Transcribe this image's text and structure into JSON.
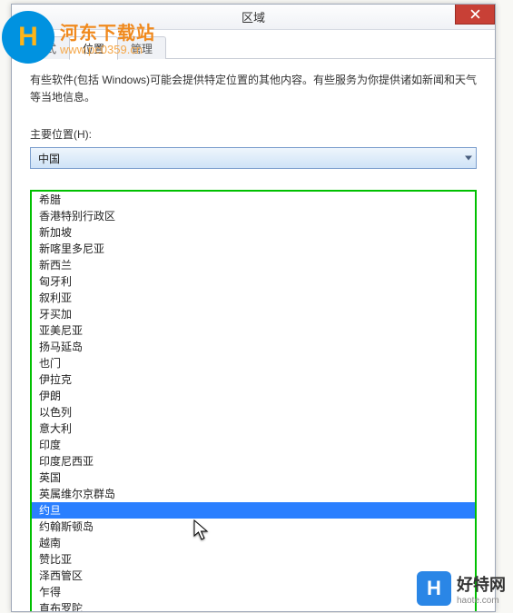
{
  "window": {
    "title": "区域",
    "close_icon": "close"
  },
  "tabs": {
    "t1": "格式",
    "t2": "位置",
    "t3": "管理"
  },
  "body": {
    "description": "有些软件(包括 Windows)可能会提供特定位置的其他内容。有些服务为你提供诸如新闻和天气等当地信息。",
    "field_label": "主要位置(H):",
    "selected_value": "中国"
  },
  "options": [
    "希腊",
    "香港特别行政区",
    "新加坡",
    "新喀里多尼亚",
    "新西兰",
    "匈牙利",
    "叙利亚",
    "牙买加",
    "亚美尼亚",
    "扬马延岛",
    "也门",
    "伊拉克",
    "伊朗",
    "以色列",
    "意大利",
    "印度",
    "印度尼西亚",
    "英国",
    "英属维尔京群岛",
    "约旦",
    "约翰斯顿岛",
    "越南",
    "赞比亚",
    "泽西管区",
    "乍得",
    "直布罗陀"
  ],
  "highlighted_index": 19,
  "watermark_top": {
    "logo_letter": "H",
    "line1": "河东下载站",
    "line2": "www.pc0359.cn"
  },
  "watermark_bottom": {
    "logo_letter": "H",
    "line1": "好特网",
    "line2": "haote.com"
  }
}
